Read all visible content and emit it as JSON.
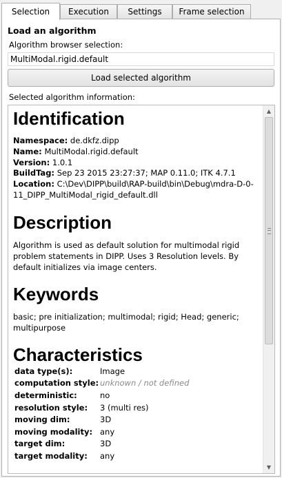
{
  "tabs": [
    "Selection",
    "Execution",
    "Settings",
    "Frame selection"
  ],
  "group_title": "Load an algorithm",
  "browser_label": "Algorithm browser selection:",
  "browser_value": "MultiModal.rigid.default",
  "load_button": "Load selected algorithm",
  "info_label": "Selected algorithm information:",
  "identification": {
    "heading": "Identification",
    "namespace_key": "Namespace:",
    "namespace_val": "de.dkfz.dipp",
    "name_key": "Name:",
    "name_val": "MultiModal.rigid.default",
    "version_key": "Version:",
    "version_val": "1.0.1",
    "buildtag_key": "BuildTag:",
    "buildtag_val": "Sep 23 2015 23:27:37; MAP 0.11.0; ITK 4.7.1",
    "location_key": "Location:",
    "location_val": "C:\\Dev\\DIPP\\build\\RAP-build\\bin\\Debug\\mdra-D-0-11_DIPP_MultiModal_rigid_default.dll"
  },
  "description": {
    "heading": "Description",
    "text": "Algorithm is used as default solution for multimodal rigid problem statements in DIPP. Uses 3 Resolution levels. By default initializes via image centers."
  },
  "keywords": {
    "heading": "Keywords",
    "text": "basic; pre initialization; multimodal; rigid; Head; generic; multipurpose"
  },
  "characteristics": {
    "heading": "Characteristics",
    "rows": [
      [
        "data type(s):",
        "Image"
      ],
      [
        "computation style:",
        "unknown / not defined"
      ],
      [
        "deterministic:",
        "no"
      ],
      [
        "resolution style:",
        "3 (multi res)"
      ],
      [
        "moving dim:",
        "3D"
      ],
      [
        "moving modality:",
        "any"
      ],
      [
        "target dim:",
        "3D"
      ],
      [
        "target modality:",
        "any"
      ]
    ]
  },
  "scrollbar": {
    "up_icon": "▲",
    "down_icon": "▼"
  }
}
